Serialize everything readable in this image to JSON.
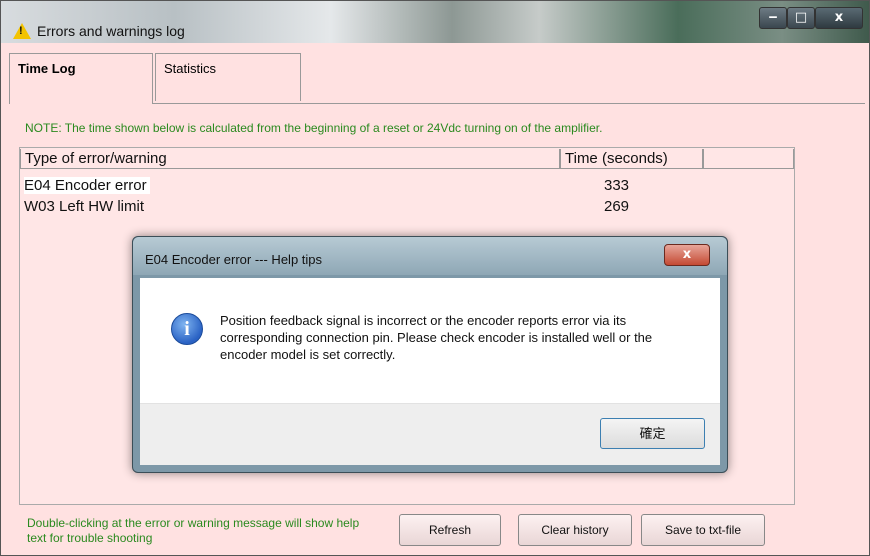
{
  "window": {
    "title": "Errors and warnings log",
    "controls": {
      "minimize": "‒",
      "maximize": "□",
      "close": "x"
    }
  },
  "tabs": [
    {
      "label": "Time Log",
      "active": true
    },
    {
      "label": "Statistics",
      "active": false
    }
  ],
  "note": "NOTE: The time shown below is calculated from the beginning of a reset or 24Vdc turning on of the amplifier.",
  "table": {
    "columns": [
      "Type of error/warning",
      "Time (seconds)"
    ],
    "rows": [
      {
        "type": "E04 Encoder error",
        "time": "333"
      },
      {
        "type": "W03 Left HW limit",
        "time": "269"
      }
    ]
  },
  "footer": {
    "hint": "Double-clicking at the error or warning message will show help text for trouble shooting",
    "refresh_label": "Refresh",
    "clear_label": "Clear history",
    "save_label": "Save to txt-file"
  },
  "dialog": {
    "title": "E04 Encoder error --- Help tips",
    "message": "Position feedback signal is incorrect or the encoder reports error via its corresponding connection pin. Please check encoder is installed well or the encoder model is set correctly.",
    "ok_label": "確定",
    "close_glyph": "x",
    "icon_glyph": "i"
  },
  "colors": {
    "window_bg": "#ffe1e1",
    "note_text": "#2b8a1f",
    "dialog_frame": "#7d98a8"
  }
}
